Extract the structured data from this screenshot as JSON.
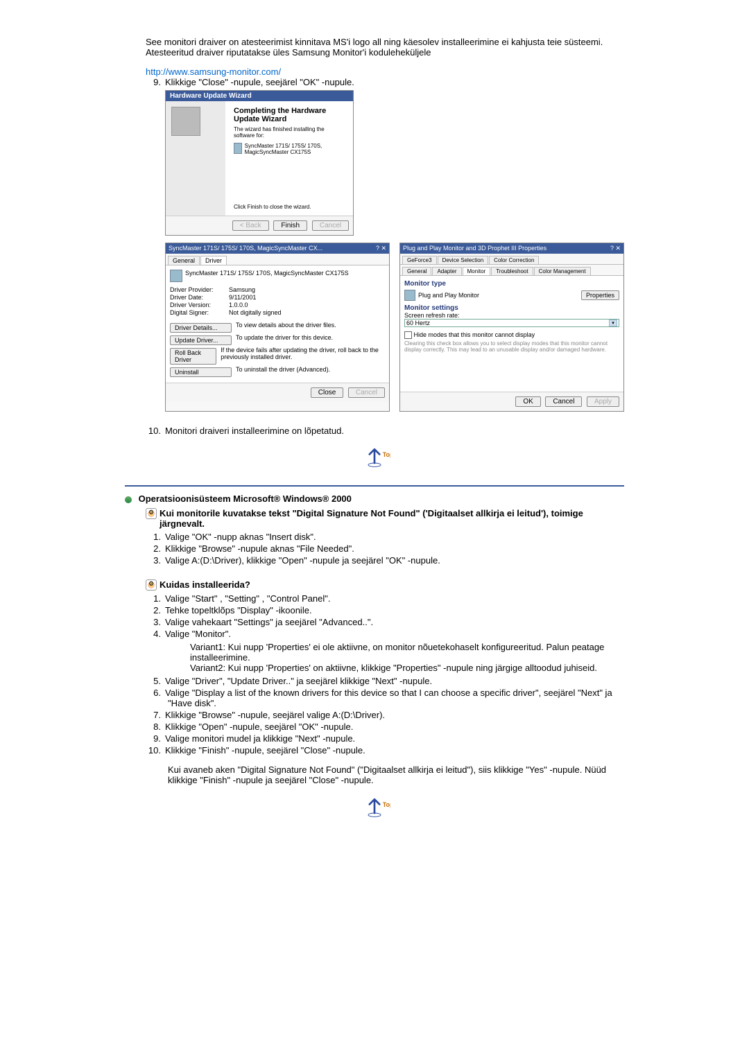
{
  "intro": {
    "paragraph": "See monitori draiver on atesteerimist kinnitava MS'i logo all ning käesolev installeerimine ei kahjusta teie süsteemi. Atesteeritud draiver riputatakse üles Samsung Monitor'i koduleheküljele",
    "link_text": "http://www.samsung-monitor.com/",
    "step9": "Klikkige \"Close\" -nupule, seejärel \"OK\" -nupule."
  },
  "wizard": {
    "title": "Hardware Update Wizard",
    "heading": "Completing the Hardware Update Wizard",
    "line1": "The wizard has finished installing the software for:",
    "device": "SyncMaster 171S/ 175S/ 170S, MagicSyncMaster CX175S",
    "finish_hint": "Click Finish to close the wizard.",
    "btn_back": "< Back",
    "btn_finish": "Finish",
    "btn_cancel": "Cancel"
  },
  "props_left": {
    "title": "SyncMaster 171S/ 175S/ 170S, MagicSyncMaster CX...",
    "tab_general": "General",
    "tab_driver": "Driver",
    "device": "SyncMaster 171S/ 175S/ 170S, MagicSyncMaster CX175S",
    "provider_lbl": "Driver Provider:",
    "provider_val": "Samsung",
    "date_lbl": "Driver Date:",
    "date_val": "9/11/2001",
    "version_lbl": "Driver Version:",
    "version_val": "1.0.0.0",
    "signer_lbl": "Digital Signer:",
    "signer_val": "Not digitally signed",
    "btn_details": "Driver Details...",
    "desc_details": "To view details about the driver files.",
    "btn_update": "Update Driver...",
    "desc_update": "To update the driver for this device.",
    "btn_rollback": "Roll Back Driver",
    "desc_rollback": "If the device fails after updating the driver, roll back to the previously installed driver.",
    "btn_uninstall": "Uninstall",
    "desc_uninstall": "To uninstall the driver (Advanced).",
    "btn_close": "Close",
    "btn_cancel": "Cancel"
  },
  "props_right": {
    "title": "Plug and Play Monitor and 3D Prophet III Properties",
    "tabs": {
      "geforce": "GeForce3",
      "device_sel": "Device Selection",
      "color_corr": "Color Correction",
      "general": "General",
      "adapter": "Adapter",
      "monitor": "Monitor",
      "troubleshoot": "Troubleshoot",
      "color_mgmt": "Color Management"
    },
    "mtype_lbl": "Monitor type",
    "mtype_val": "Plug and Play Monitor",
    "btn_props": "Properties",
    "settings_lbl": "Monitor settings",
    "refresh_lbl": "Screen refresh rate:",
    "refresh_val": "60 Hertz",
    "hide_lbl": "Hide modes that this monitor cannot display",
    "hide_desc": "Clearing this check box allows you to select display modes that this monitor cannot display correctly. This may lead to an unusable display and/or damaged hardware.",
    "btn_ok": "OK",
    "btn_cancel": "Cancel",
    "btn_apply": "Apply"
  },
  "step10": "Monitori draiveri installeerimine on lõpetatud.",
  "top_label": "Top",
  "os_heading": "Operatsioonisüsteem Microsoft® Windows® 2000",
  "dig_sig_intro": "Kui monitorile kuvatakse tekst \"Digital Signature Not Found\" ('Digitaalset allkirja ei leitud'), toimige järgnevalt.",
  "list1": {
    "i1": "Valige \"OK\" -nupp aknas \"Insert disk\".",
    "i2": "Klikkige \"Browse\" -nupule aknas \"File Needed\".",
    "i3": "Valige A:(D:\\Driver), klikkige \"Open\" -nupule ja seejärel \"OK\" -nupule."
  },
  "install_heading": "Kuidas installeerida?",
  "list2": {
    "i1": "Valige \"Start\" , \"Setting\" , \"Control Panel\".",
    "i2": "Tehke topeltklõps \"Display\" -ikoonile.",
    "i3": "Valige vahekaart \"Settings\" ja seejärel \"Advanced..\".",
    "i4": "Valige \"Monitor\".",
    "i4v1": "Variant1: Kui nupp 'Properties' ei ole aktiivne, on monitor nõuetekohaselt konfigureeritud. Palun peatage installeerimine.",
    "i4v2": "Variant2: Kui nupp 'Properties' on aktiivne, klikkige \"Properties\" -nupule ning järgige alltoodud juhiseid.",
    "i5": "Valige \"Driver\", \"Update Driver..\" ja seejärel klikkige \"Next\" -nupule.",
    "i6": "Valige \"Display a list of the known drivers for this device so that I can choose a specific driver\", seejärel \"Next\" ja \"Have disk\".",
    "i7": "Klikkige \"Browse\" -nupule, seejärel valige A:(D:\\Driver).",
    "i8": "Klikkige \"Open\" -nupule, seejärel \"OK\" -nupule.",
    "i9": "Valige monitori mudel ja klikkige \"Next\" -nupule.",
    "i10": "Klikkige \"Finish\" -nupule, seejärel \"Close\" -nupule."
  },
  "final_para": "Kui avaneb aken \"Digital Signature Not Found\" (\"Digitaalset allkirja ei leitud\"), siis klikkige \"Yes\" -nupule. Nüüd klikkige \"Finish\" -nupule ja seejärel \"Close\" -nupule."
}
